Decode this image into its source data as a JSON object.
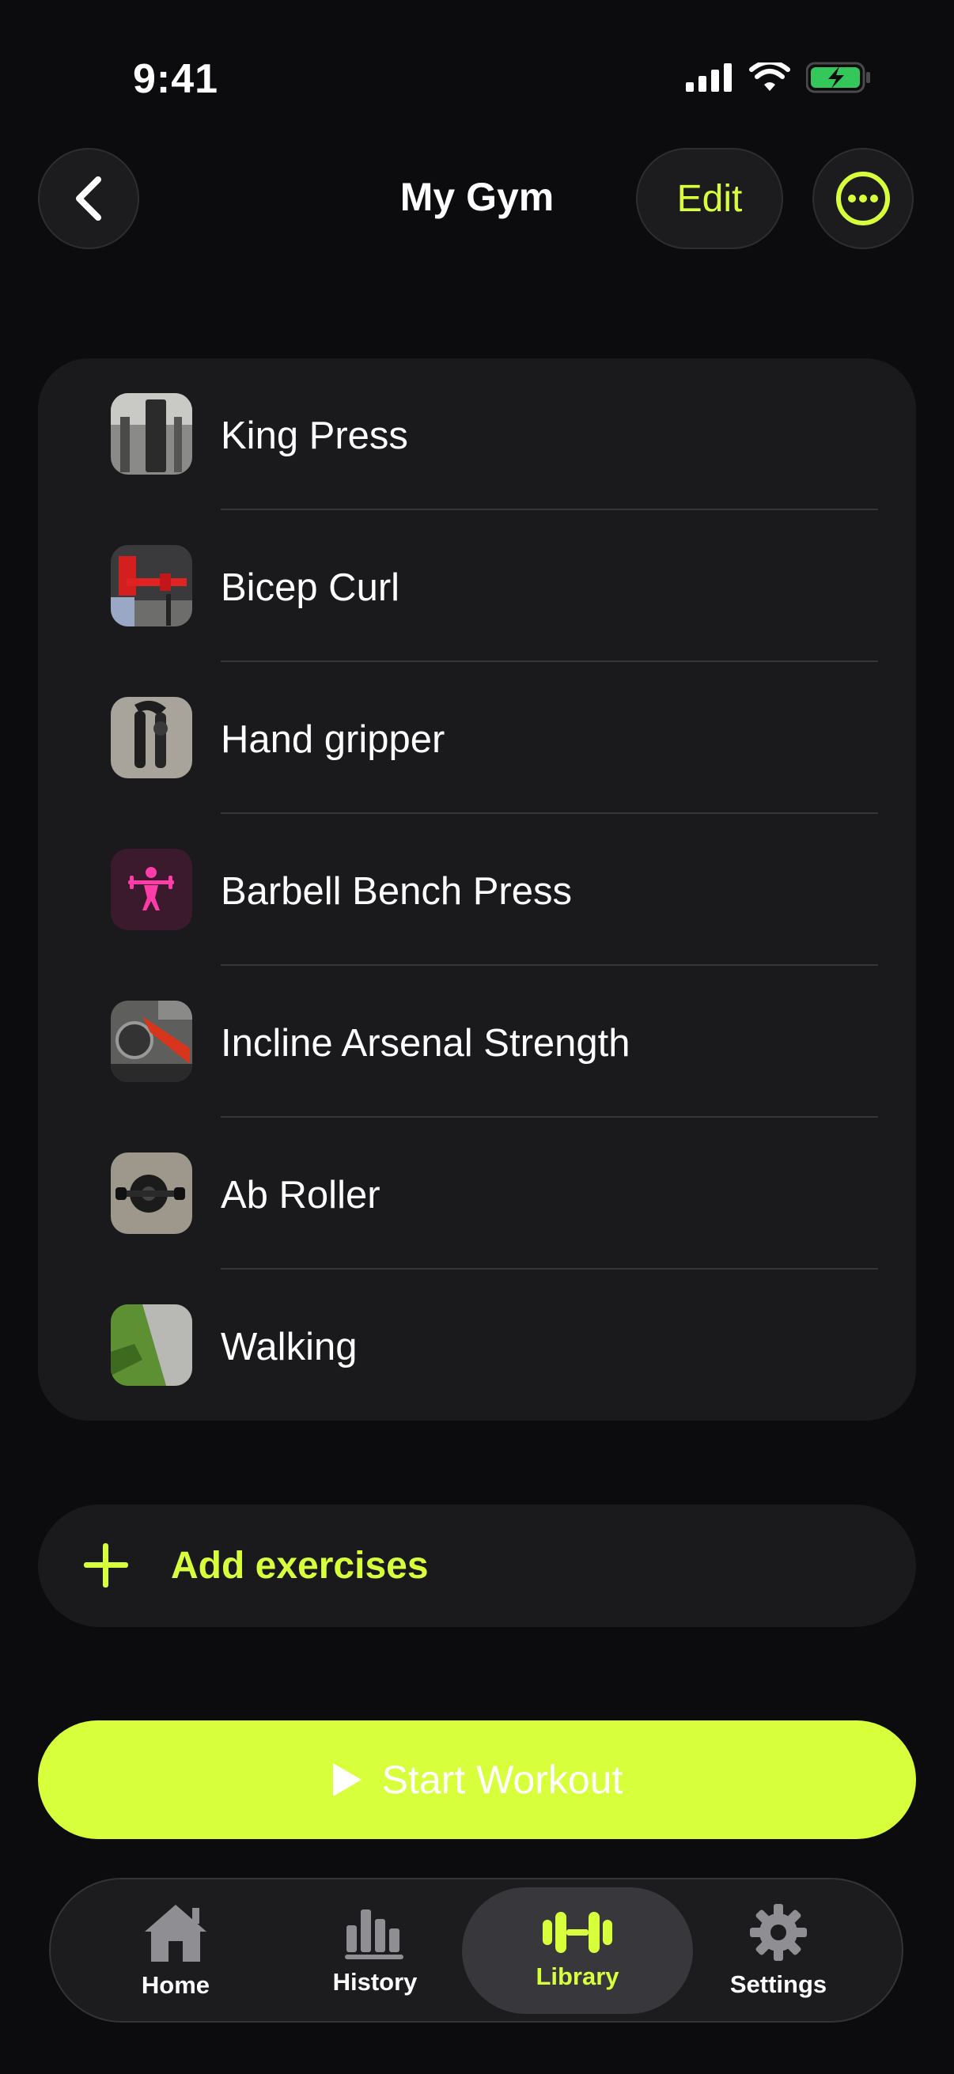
{
  "status_bar": {
    "time": "9:41"
  },
  "header": {
    "title": "My Gym",
    "edit_label": "Edit"
  },
  "exercises": [
    {
      "name": "King Press",
      "thumb": "photo-machine"
    },
    {
      "name": "Bicep Curl",
      "thumb": "photo-red-equipment"
    },
    {
      "name": "Hand gripper",
      "thumb": "photo-gripper"
    },
    {
      "name": "Barbell Bench Press",
      "thumb": "weightlifter-icon"
    },
    {
      "name": "Incline Arsenal Strength",
      "thumb": "photo-incline-machine"
    },
    {
      "name": "Ab Roller",
      "thumb": "photo-ab-roller"
    },
    {
      "name": "Walking",
      "thumb": "photo-sidewalk"
    }
  ],
  "add_exercises": {
    "label": "Add exercises"
  },
  "start_workout": {
    "label": "Start Workout"
  },
  "tabs": [
    {
      "label": "Home",
      "icon": "house-icon",
      "active": false
    },
    {
      "label": "History",
      "icon": "bar-chart-icon",
      "active": false
    },
    {
      "label": "Library",
      "icon": "dumbbell-icon",
      "active": true
    },
    {
      "label": "Settings",
      "icon": "gear-icon",
      "active": false
    }
  ],
  "colors": {
    "accent": "#d8ff3c",
    "background": "#0c0c0e",
    "card": "#1a1a1d",
    "barbell_icon": "#ff3ca8"
  }
}
